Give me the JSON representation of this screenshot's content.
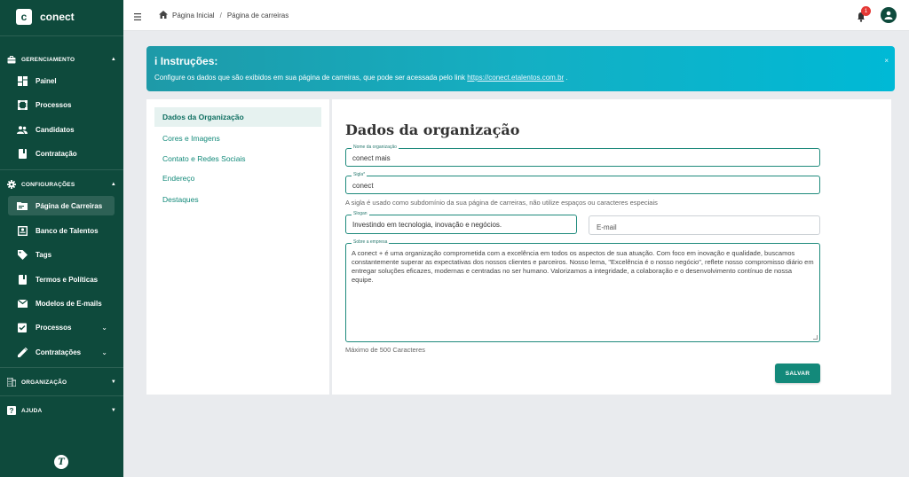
{
  "app": {
    "logo_letter": "c",
    "name": "conect",
    "bottom_logo_letter": "T"
  },
  "sidebar": {
    "sections": [
      {
        "label": "GERENCIAMENTO",
        "icon": "briefcase-icon"
      },
      {
        "label": "CONFIGURAÇÕES",
        "icon": "gear-icon"
      },
      {
        "label": "ORGANIZAÇÃO",
        "icon": "building-icon"
      },
      {
        "label": "AJUDA",
        "icon": "help-icon"
      }
    ],
    "items": [
      {
        "label": "Painel",
        "icon": "dashboard-icon"
      },
      {
        "label": "Processos",
        "icon": "process-icon"
      },
      {
        "label": "Candidatos",
        "icon": "people-icon"
      },
      {
        "label": "Contratação",
        "icon": "contract-icon"
      },
      {
        "label": "Página de Carreiras",
        "icon": "folder-icon",
        "active": true
      },
      {
        "label": "Banco de Talentos",
        "icon": "id-card-icon"
      },
      {
        "label": "Tags",
        "icon": "tag-icon"
      },
      {
        "label": "Termos e Políticas",
        "icon": "document-icon"
      },
      {
        "label": "Modelos de E-mails",
        "icon": "mail-icon"
      },
      {
        "label": "Processos",
        "icon": "checklist-icon"
      },
      {
        "label": "Contratações",
        "icon": "pen-icon"
      }
    ]
  },
  "topbar": {
    "breadcrumb": {
      "home": "Página Inicial",
      "separator": "/",
      "current": "Página de carreiras"
    },
    "notification_count": "1"
  },
  "banner": {
    "icon": "i",
    "title": "Instruções:",
    "text": "Configure os dados que são exibidos em sua página de carreiras, que pode ser acessada pelo link",
    "link": "https://conect.etalentos.com.br",
    "link_suffix": ".",
    "close": "×"
  },
  "leftmenu": {
    "items": [
      {
        "label": "Dados da Organização",
        "active": true
      },
      {
        "label": "Cores e Imagens"
      },
      {
        "label": "Contato e Redes Sociais"
      },
      {
        "label": "Endereço"
      },
      {
        "label": "Destaques"
      }
    ]
  },
  "form": {
    "title": "Dados da organização",
    "org_name": {
      "label": "Nome da organização",
      "value": "conect mais"
    },
    "sigla": {
      "label": "Sigla*",
      "value": "conect",
      "help": "A sigla é usado como subdomínio da sua página de carreiras, não utilize espaços ou caracteres especiais"
    },
    "slogan": {
      "label": "Slogan",
      "value": "Investindo em tecnologia, inovação e negócios."
    },
    "email": {
      "placeholder": "E-mail"
    },
    "about": {
      "label": "Sobre a empresa",
      "value": "A conect + é uma organização comprometida com a excelência em todos os aspectos de sua atuação. Com foco em inovação e qualidade, buscamos constantemente superar as expectativas dos nossos clientes e parceiros. Nosso lema, \"Excelência é o nosso negócio\", reflete nosso compromisso diário em entregar soluções eficazes, modernas e centradas no ser humano. Valorizamos a integridade, a colaboração e o desenvolvimento contínuo de nossa equipe.",
      "help": "Máximo de 500 Caracteres"
    },
    "save_label": "SALVAR"
  },
  "colors": {
    "sidebar": "#0e4a3c",
    "accent": "#13897a",
    "banner": "#14afc3",
    "badge": "#e53935"
  }
}
